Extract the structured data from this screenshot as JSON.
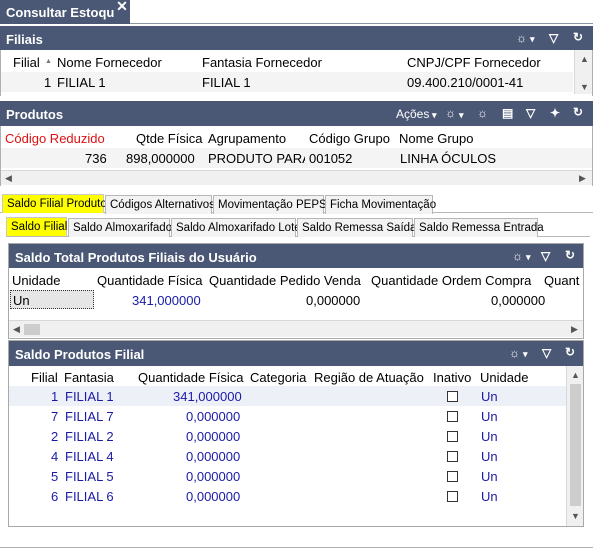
{
  "window": {
    "tab_title": "Consultar Estoqu",
    "close_glyph": "✕"
  },
  "icons": {
    "filter": "▽",
    "refresh": "↻",
    "dropdown": "▾",
    "sort_up": "▲",
    "sun": "☼",
    "grid": "▤",
    "pin": "✦"
  },
  "filiais": {
    "title": "Filiais",
    "columns": [
      "Filial",
      "Nome Fornecedor",
      "Fantasia Fornecedor",
      "CNPJ/CPF Fornecedor"
    ],
    "row": {
      "filial": "1",
      "nome": "FILIAL 1",
      "fantasia": "FILIAL 1",
      "cnpj": "09.400.210/0001-41"
    }
  },
  "produtos": {
    "title": "Produtos",
    "acoes_label": "Ações",
    "columns": [
      "Código Reduzido",
      "Qtde Física",
      "Agrupamento",
      "Código Grupo",
      "Nome Grupo"
    ],
    "row": {
      "codigo": "736",
      "qtde": "898,000000",
      "agrupamento": "PRODUTO PARA",
      "codigo_grupo": "001052",
      "nome_grupo": "LINHA ÓCULOS"
    }
  },
  "tabs_main": [
    "Saldo Filial Produto",
    "Códigos Alternativos",
    "Movimentação PEPS",
    "Ficha Movimentação"
  ],
  "tabs_sub": [
    "Saldo Filial",
    "Saldo Almoxarifado",
    "Saldo Almoxarifado Lote",
    "Saldo Remessa Saída",
    "Saldo Remessa Entrada"
  ],
  "saldo_total": {
    "title": "Saldo Total Produtos Filiais do Usuário",
    "columns": [
      "Unidade",
      "Quantidade Física",
      "Quantidade Pedido Venda",
      "Quantidade Ordem Compra",
      "Quant"
    ],
    "row": {
      "unidade": "Un",
      "qtd_fisica": "341,000000",
      "qtd_pedido": "0,000000",
      "qtd_ordem": "0,000000"
    }
  },
  "saldo_filial": {
    "title": "Saldo Produtos Filial",
    "columns": [
      "Filial",
      "Fantasia",
      "Quantidade Física",
      "Categoria",
      "Região de Atuação",
      "Inativo",
      "Unidade"
    ],
    "rows": [
      {
        "filial": "1",
        "fantasia": "FILIAL 1",
        "qtd": "341,000000",
        "unidade": "Un"
      },
      {
        "filial": "7",
        "fantasia": "FILIAL 7",
        "qtd": "0,000000",
        "unidade": "Un"
      },
      {
        "filial": "2",
        "fantasia": "FILIAL 2",
        "qtd": "0,000000",
        "unidade": "Un"
      },
      {
        "filial": "4",
        "fantasia": "FILIAL 4",
        "qtd": "0,000000",
        "unidade": "Un"
      },
      {
        "filial": "5",
        "fantasia": "FILIAL 5",
        "qtd": "0,000000",
        "unidade": "Un"
      },
      {
        "filial": "6",
        "fantasia": "FILIAL 6",
        "qtd": "0,000000",
        "unidade": "Un"
      }
    ]
  }
}
